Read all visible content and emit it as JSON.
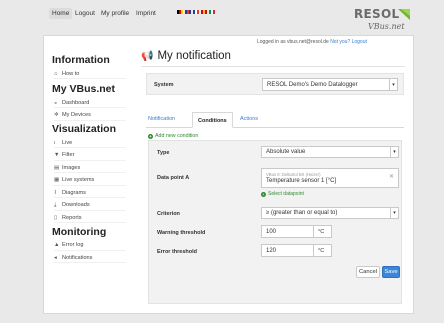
{
  "nav": {
    "home": "Home",
    "logout": "Logout",
    "profile": "My profile",
    "imprint": "Imprint"
  },
  "logo": {
    "name": "RESOL",
    "sub": "VBus.net",
    "brand_color": "#6fb72f"
  },
  "sidebar": {
    "information_heading": "Information",
    "howto": "How to",
    "myvbus_heading": "My VBus.net",
    "dashboard": "Dashboard",
    "devices": "My Devices",
    "visualization_heading": "Visualization",
    "live": "Live",
    "filter": "Filter",
    "images": "Images",
    "live_systems": "Live systems",
    "diagrams": "Diagrams",
    "downloads": "Downloads",
    "reports": "Reports",
    "monitoring_heading": "Monitoring",
    "error_log": "Error log",
    "notifications": "Notifications"
  },
  "header": {
    "logged_prefix": "Logged in as vbus.net@resol.de",
    "logged_link": "Not you? Logout"
  },
  "page": {
    "title": "My notification",
    "system_label": "System",
    "system_value": "RESOL Demo's Demo Datalogger"
  },
  "tabs": {
    "notification": "Notification",
    "conditions": "Conditions",
    "actions": "Actions"
  },
  "conditions": {
    "add_label": "Add new condition",
    "type_label": "Type",
    "type_value": "Absolute value",
    "datapoint_label": "Data point A",
    "datapoint_small": "VBus 0: DeltaSol BX (Heizer)",
    "datapoint_value": "Temperature sensor 1 [°C]",
    "select_datapoint": "Select datapoint",
    "criterion_label": "Criterion",
    "criterion_value": "≥ (greater than or equal to)",
    "warning_label": "Warning threshold",
    "warning_value": "100",
    "warning_unit": "°C",
    "error_label": "Error threshold",
    "error_value": "120",
    "error_unit": "°C"
  },
  "buttons": {
    "cancel": "Cancel",
    "save": "Save"
  }
}
